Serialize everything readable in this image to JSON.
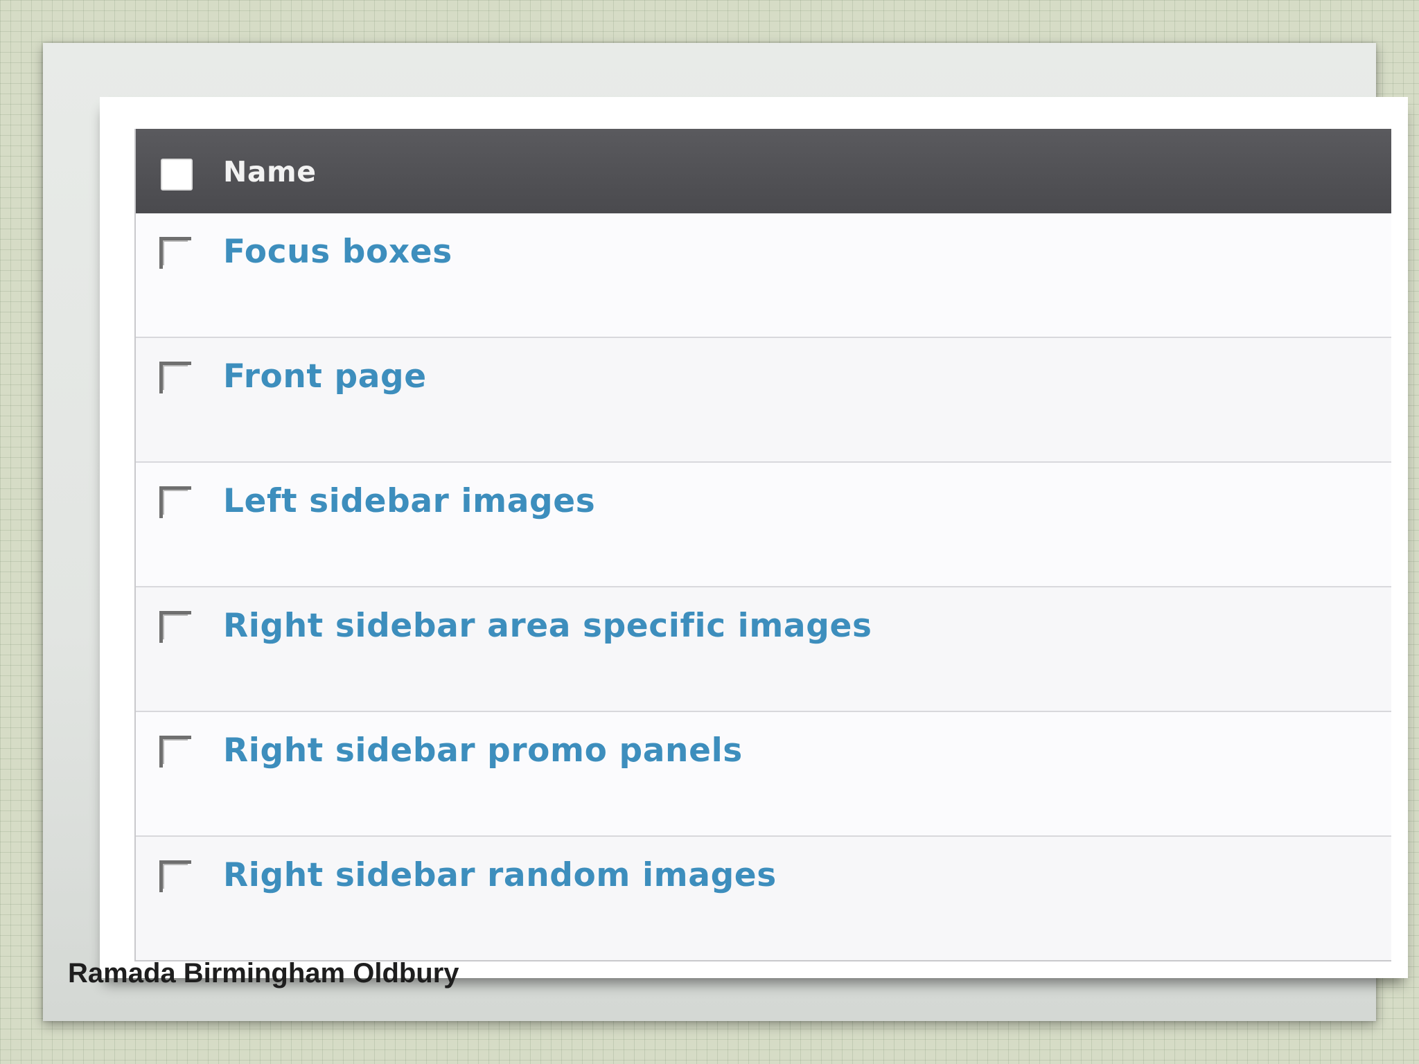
{
  "table": {
    "header": {
      "label": "Name",
      "select_all_checked": false
    },
    "rows": [
      {
        "label": "Focus boxes",
        "checked": false
      },
      {
        "label": "Front page",
        "checked": false
      },
      {
        "label": "Left sidebar images",
        "checked": false
      },
      {
        "label": "Right sidebar area specific images",
        "checked": false
      },
      {
        "label": "Right sidebar promo panels",
        "checked": false
      },
      {
        "label": "Right sidebar random images",
        "checked": false
      }
    ]
  },
  "caption": "Ramada Birmingham Oldbury",
  "colors": {
    "header_bg": "#505054",
    "link": "#3d8ebd",
    "background_grid": "#d6dcc6"
  }
}
